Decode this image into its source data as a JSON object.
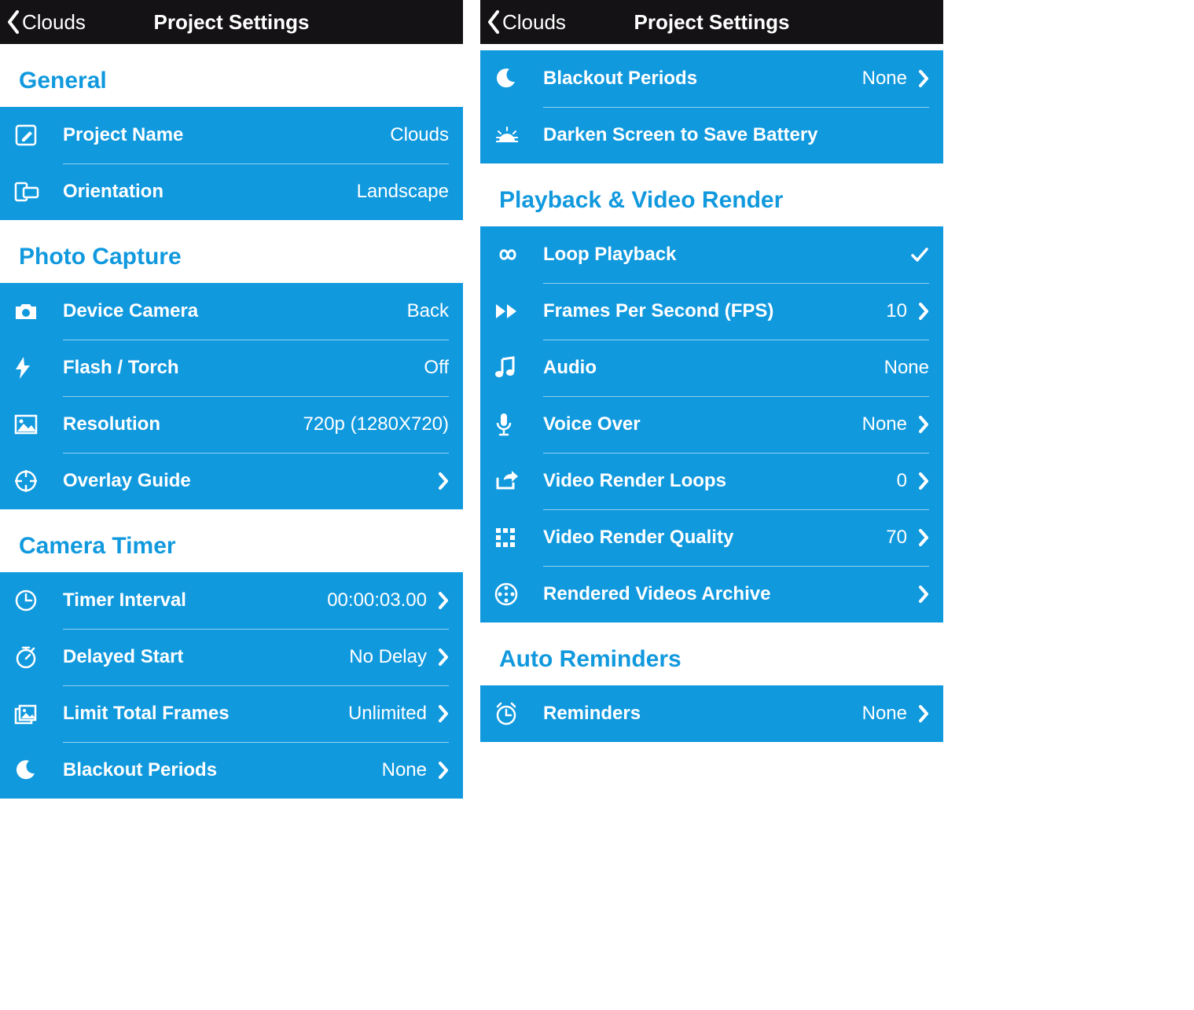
{
  "accent": "#1199de",
  "paneA": {
    "nav": {
      "back": "Clouds",
      "title": "Project Settings"
    },
    "sections": {
      "general": {
        "header": "General",
        "project_name": {
          "label": "Project Name",
          "value": "Clouds"
        },
        "orientation": {
          "label": "Orientation",
          "value": "Landscape"
        }
      },
      "photo_capture": {
        "header": "Photo Capture",
        "device_camera": {
          "label": "Device Camera",
          "value": "Back"
        },
        "flash": {
          "label": "Flash / Torch",
          "value": "Off"
        },
        "resolution": {
          "label": "Resolution",
          "value": "720p (1280X720)"
        },
        "overlay_guide": {
          "label": "Overlay Guide"
        }
      },
      "camera_timer": {
        "header": "Camera Timer",
        "timer_interval": {
          "label": "Timer Interval",
          "value": "00:00:03.00"
        },
        "delayed_start": {
          "label": "Delayed Start",
          "value": "No Delay"
        },
        "limit_frames": {
          "label": "Limit Total Frames",
          "value": "Unlimited"
        },
        "blackout_periods": {
          "label": "Blackout Periods",
          "value": "None"
        }
      }
    }
  },
  "paneB": {
    "nav": {
      "back": "Clouds",
      "title": "Project Settings"
    },
    "sections": {
      "timer_tail": {
        "blackout_periods": {
          "label": "Blackout Periods",
          "value": "None"
        },
        "darken_screen": {
          "label": "Darken Screen to Save Battery"
        }
      },
      "playback": {
        "header": "Playback & Video Render",
        "loop_playback": {
          "label": "Loop Playback",
          "checked": true
        },
        "fps": {
          "label": "Frames Per Second (FPS)",
          "value": "10"
        },
        "audio": {
          "label": "Audio",
          "value": "None"
        },
        "voice_over": {
          "label": "Voice Over",
          "value": "None"
        },
        "render_loops": {
          "label": "Video Render Loops",
          "value": "0"
        },
        "render_quality": {
          "label": "Video Render Quality",
          "value": "70"
        },
        "archive": {
          "label": "Rendered Videos Archive"
        }
      },
      "reminders": {
        "header": "Auto Reminders",
        "reminders": {
          "label": "Reminders",
          "value": "None"
        }
      }
    }
  }
}
